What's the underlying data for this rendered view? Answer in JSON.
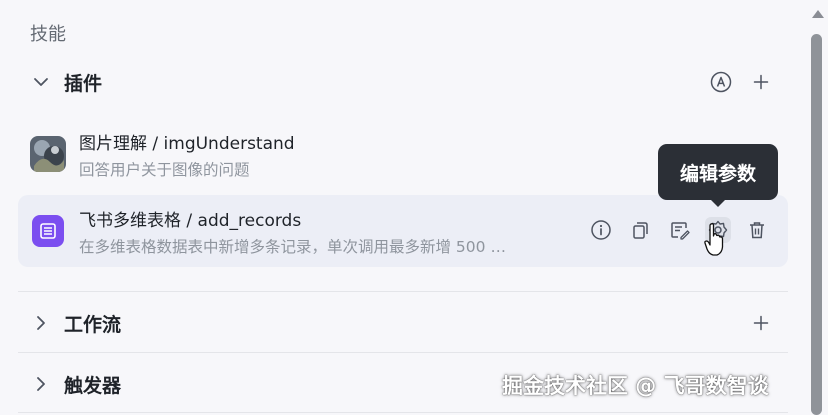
{
  "section": {
    "title": "技能"
  },
  "plugins": {
    "label": "插件",
    "items": [
      {
        "name": "图片理解 / imgUnderstand",
        "description": "回答用户关于图像的问题",
        "icon": "image-thumbnail"
      },
      {
        "name": "飞书多维表格 / add_records",
        "description": "在多维表格数据表中新增多条记录，单次调用最多新增 500 …",
        "icon": "bitable-icon"
      }
    ]
  },
  "tooltip": {
    "text": "编辑参数"
  },
  "groups": [
    {
      "label": "工作流"
    },
    {
      "label": "触发器"
    }
  ],
  "watermark": {
    "text": "掘金技术社区 @ 飞哥数智谈"
  },
  "colors": {
    "accent": "#7b4ef0",
    "tooltip_bg": "#2b2f36",
    "hover_bg": "#eceef6"
  }
}
